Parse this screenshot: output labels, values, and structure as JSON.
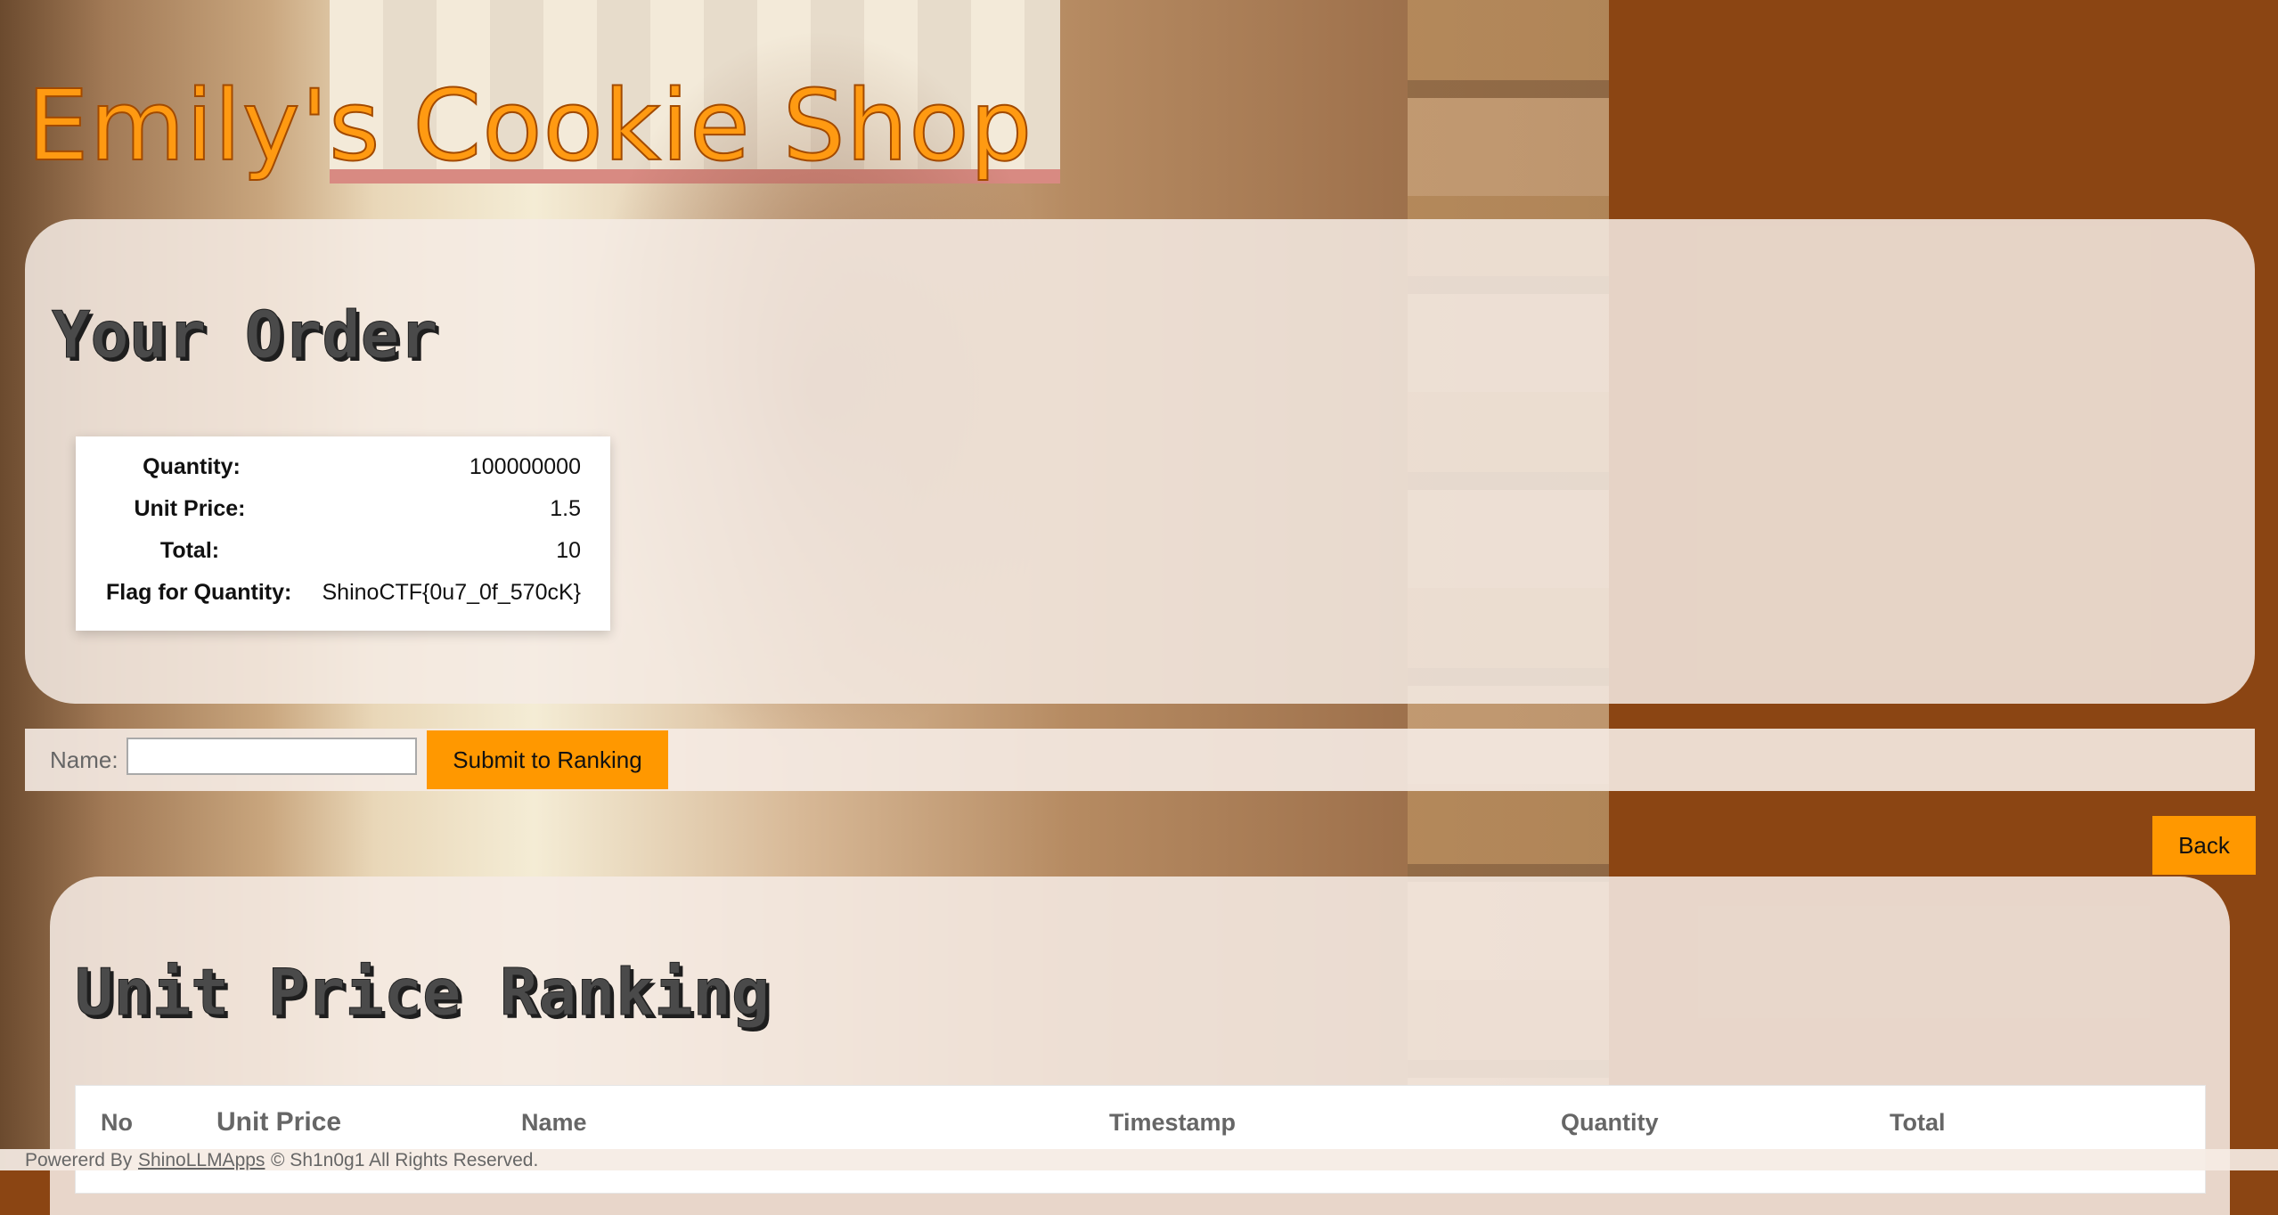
{
  "shop_title": "Emily's Cookie Shop",
  "order": {
    "heading": "Your Order",
    "rows": [
      {
        "label": "Quantity:",
        "value": "100000000"
      },
      {
        "label": "Unit Price:",
        "value": "1.5"
      },
      {
        "label": "Total:",
        "value": "10"
      },
      {
        "label": "Flag for Quantity:",
        "value": "ShinoCTF{0u7_0f_570cK}"
      }
    ]
  },
  "ranking_form": {
    "name_label": "Name:",
    "name_value": "",
    "name_placeholder": "",
    "submit_label": "Submit to Ranking"
  },
  "back_label": "Back",
  "ranking": {
    "heading": "Unit Price Ranking",
    "columns": [
      "No",
      "Unit Price",
      "Name",
      "Timestamp",
      "Quantity",
      "Total"
    ]
  },
  "footer": {
    "prefix": "Powererd By",
    "link": "ShinoLLMApps",
    "suffix": "© Sh1n0g1 All Rights Reserved."
  },
  "colors": {
    "background": "#8b4513",
    "accent": "#ff9800",
    "title": "#ff9a12"
  }
}
